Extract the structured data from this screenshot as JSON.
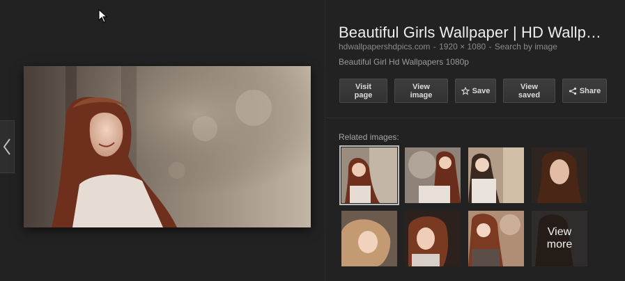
{
  "panel": {
    "title": "Beautiful Girls Wallpaper | HD Wallp…",
    "source_domain": "hdwallpapershdpics.com",
    "separator": "-",
    "dimensions": "1920 × 1080",
    "search_by_image": "Search by image",
    "description": "Beautiful Girl Hd Wallpapers 1080p"
  },
  "actions": {
    "visit_line1": "Visit",
    "visit_line2": "page",
    "view_image_line1": "View",
    "view_image_line2": "image",
    "save": "Save",
    "view_saved_line1": "View",
    "view_saved_line2": "saved",
    "share": "Share"
  },
  "related": {
    "label": "Related images:",
    "view_more_line1": "View",
    "view_more_line2": "more"
  },
  "icons": [
    "chevron-left-icon",
    "star-icon",
    "share-icon",
    "cursor-icon"
  ],
  "colors": {
    "background": "#222222",
    "button": "#383838",
    "text": "#eeeeee",
    "muted": "#8b8b8b"
  }
}
